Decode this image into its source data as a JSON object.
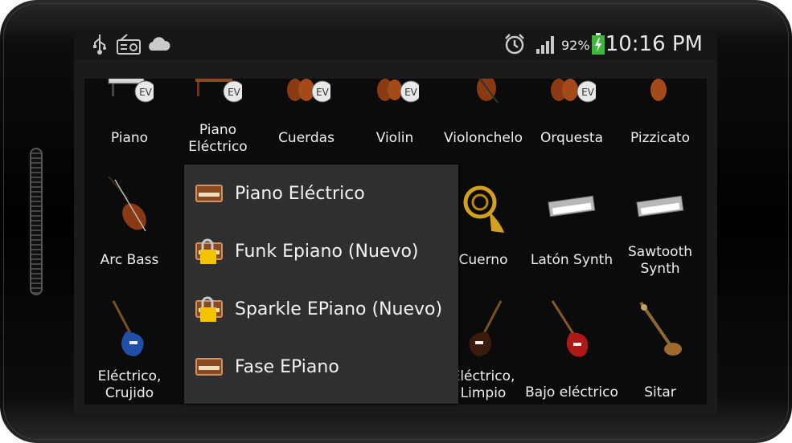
{
  "status_bar": {
    "icons_left": [
      "usb-icon",
      "radio-icon",
      "cloud-icon"
    ],
    "icons_right": [
      "alarm-icon",
      "signal-icon",
      "battery-charging-icon"
    ],
    "battery": "92%",
    "time": "10:16 PM"
  },
  "instruments": {
    "row1": [
      "Piano",
      "Piano Eléctrico",
      "Cuerdas",
      "Violin",
      "Violonchelo",
      "Orquesta",
      "Pizzicato"
    ],
    "row2": [
      "Arc Bass",
      "",
      "",
      "",
      "Cuerno",
      "Latón Synth",
      "Sawtooth Synth"
    ],
    "row3": [
      "Eléctrico, Crujido",
      "",
      "",
      "",
      "Eléctrico, Limpio",
      "Bajo eléctrico",
      "Sitar"
    ]
  },
  "popup_menu": {
    "items": [
      {
        "label": "Piano Eléctrico",
        "icon": "organ-icon",
        "locked": false
      },
      {
        "label": "Funk Epiano (Nuevo)",
        "icon": "organ-locked-icon",
        "locked": true
      },
      {
        "label": "Sparkle EPiano (Nuevo)",
        "icon": "organ-locked-icon",
        "locked": true
      },
      {
        "label": "Fase EPiano",
        "icon": "organ-icon",
        "locked": false
      }
    ]
  },
  "colors": {
    "menu_bg": "#2f2f2f",
    "screen_bg": "#0b0b0b",
    "lock": "#f5c400",
    "wood": "#8a4a1f"
  }
}
